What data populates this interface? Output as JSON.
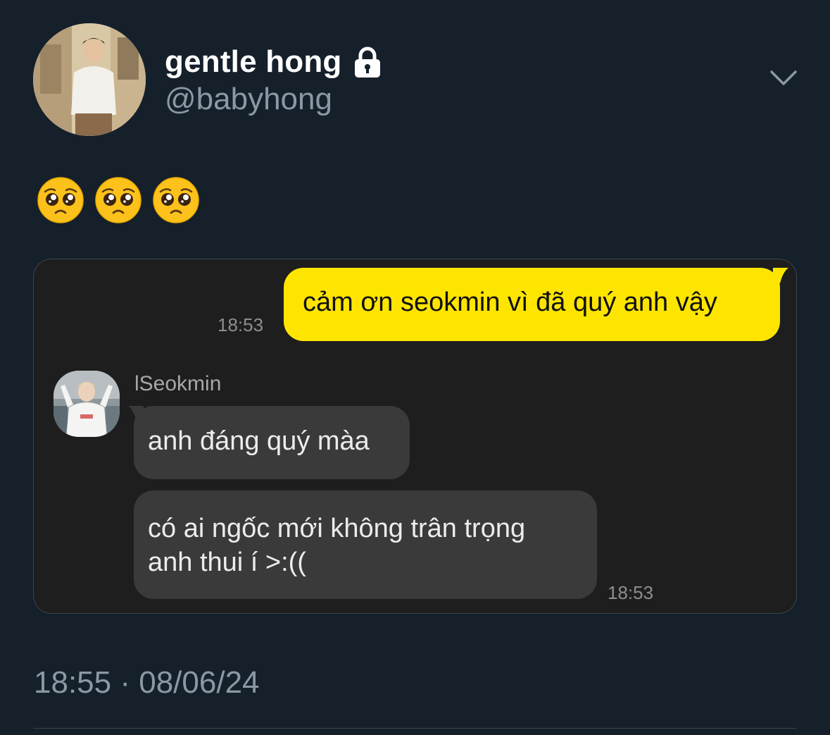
{
  "tweet": {
    "display_name": "gentle hong",
    "handle": "@babyhong",
    "protected_icon": "lock-icon",
    "menu_icon": "chevron-down-icon",
    "emojis": [
      "🥺",
      "🥺",
      "🥺"
    ],
    "time": "18:55",
    "separator": "·",
    "date": "08/06/24"
  },
  "chat": {
    "messages": [
      {
        "direction": "outgoing",
        "text": "cảm ơn seokmin vì đã quý anh vậy",
        "time": "18:53"
      },
      {
        "direction": "incoming",
        "sender": "lSeokmin",
        "text": "anh đáng quý màa"
      },
      {
        "direction": "incoming",
        "lines": [
          "có ai ngốc mới không trân trọng",
          "anh thui í >:(("
        ],
        "time": "18:53"
      }
    ]
  },
  "colors": {
    "background": "#15202b",
    "outgoing_bubble": "#fee500",
    "incoming_bubble": "#3a3a3a",
    "muted_text": "#8b98a5"
  }
}
